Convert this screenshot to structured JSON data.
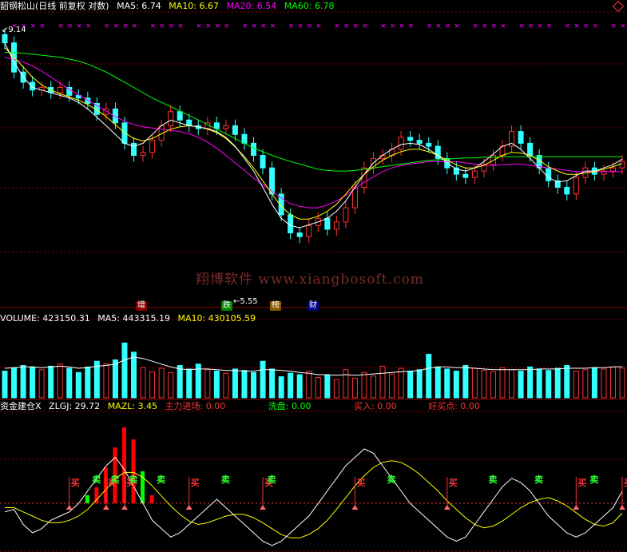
{
  "header_main": {
    "title": "韶钢松山(日线 前复权 对数)",
    "items": [
      {
        "label": "MA5: 6.74",
        "color": "#ffffff"
      },
      {
        "label": "MA10: 6.67",
        "color": "#ffff00"
      },
      {
        "label": "MA20: 6.54",
        "color": "#ff00ff"
      },
      {
        "label": "MA60: 6.78",
        "color": "#00ff00"
      }
    ]
  },
  "header_volume": {
    "items": [
      {
        "label": "VOLUME: 423150.31",
        "color": "#ffffff"
      },
      {
        "label": "MA5: 443315.19",
        "color": "#ffffff"
      },
      {
        "label": "MA10: 430105.59",
        "color": "#ffff00"
      }
    ]
  },
  "header_indicator": {
    "items": [
      {
        "label": "资金建仓X",
        "color": "#ffffff"
      },
      {
        "label": "ZLGJ: 29.72",
        "color": "#ffffff"
      },
      {
        "label": "MAZL: 3.45",
        "color": "#ffff00"
      },
      {
        "label": "主力进场: 0.00",
        "color": "#ff3333"
      },
      {
        "label": "洗盘: 0.00",
        "color": "#00ff00"
      },
      {
        "label": "买入: 0.00",
        "color": "#ff3333"
      },
      {
        "label": "好买点: 0.00",
        "color": "#ff3333"
      }
    ]
  },
  "price_marks": {
    "high": "9.14",
    "low": "5.55"
  },
  "events": [
    {
      "label": "增",
      "bg": "#880000",
      "fg": "#ffffff"
    },
    {
      "label": "跌",
      "bg": "#008800",
      "fg": "#ffffff"
    },
    {
      "label": "榜",
      "bg": "#885500",
      "fg": "#ffffff"
    },
    {
      "label": "财",
      "bg": "#000088",
      "fg": "#ffffff"
    }
  ],
  "watermark": "翔博软件 www.xiangbosoft.com",
  "signals": {
    "buy": "买",
    "sell": "卖"
  },
  "colors": {
    "up": "#ff3333",
    "down": "#33ffff",
    "ma5": "#ffffff",
    "ma10": "#ffff00",
    "ma20": "#ff00ff",
    "ma60": "#00ff00",
    "grid": "#8b0000"
  },
  "chart_data": [
    {
      "type": "candlestick",
      "scale": "log",
      "high_label": 9.14,
      "low_label": 5.55,
      "ylim": [
        5.2,
        9.4
      ],
      "close_approx": [
        8.9,
        8.3,
        8.1,
        7.95,
        8.0,
        7.9,
        8.0,
        7.85,
        7.8,
        7.7,
        7.5,
        7.6,
        7.35,
        7.0,
        6.8,
        6.85,
        7.05,
        7.3,
        7.55,
        7.4,
        7.3,
        7.25,
        7.35,
        7.25,
        7.3,
        7.15,
        7.0,
        6.8,
        6.6,
        6.2,
        5.9,
        5.65,
        5.6,
        5.75,
        5.85,
        5.7,
        5.8,
        6.0,
        6.3,
        6.6,
        6.75,
        6.8,
        6.9,
        7.1,
        7.05,
        7.0,
        6.95,
        6.75,
        6.6,
        6.5,
        6.45,
        6.55,
        6.65,
        6.8,
        6.95,
        7.2,
        7.0,
        6.8,
        6.6,
        6.4,
        6.3,
        6.2,
        6.45,
        6.6,
        6.5,
        6.55,
        6.6,
        6.7
      ],
      "ma5": [
        8.9,
        8.5,
        8.2,
        8.0,
        7.95,
        7.9,
        7.85,
        7.8,
        7.72,
        7.6,
        7.45,
        7.3,
        7.15,
        7.0,
        6.95,
        7.0,
        7.15,
        7.3,
        7.4,
        7.35,
        7.3,
        7.28,
        7.25,
        7.2,
        7.1,
        6.95,
        6.75,
        6.55,
        6.3,
        6.05,
        5.85,
        5.75,
        5.72,
        5.76,
        5.8,
        5.85,
        5.95,
        6.1,
        6.3,
        6.5,
        6.68,
        6.8,
        6.9,
        6.98,
        7.0,
        6.98,
        6.9,
        6.8,
        6.68,
        6.58,
        6.55,
        6.6,
        6.7,
        6.82,
        6.95,
        7.0,
        6.9,
        6.75,
        6.6,
        6.45,
        6.38,
        6.4,
        6.48,
        6.55,
        6.55,
        6.6,
        6.65,
        6.74
      ],
      "ma10": [
        8.8,
        8.6,
        8.4,
        8.2,
        8.05,
        7.95,
        7.88,
        7.82,
        7.76,
        7.68,
        7.58,
        7.46,
        7.32,
        7.18,
        7.08,
        7.04,
        7.08,
        7.16,
        7.24,
        7.28,
        7.3,
        7.28,
        7.24,
        7.18,
        7.08,
        6.94,
        6.78,
        6.6,
        6.4,
        6.2,
        6.02,
        5.9,
        5.84,
        5.84,
        5.88,
        5.95,
        6.05,
        6.2,
        6.36,
        6.5,
        6.62,
        6.72,
        6.8,
        6.86,
        6.9,
        6.9,
        6.86,
        6.8,
        6.72,
        6.65,
        6.6,
        6.6,
        6.64,
        6.72,
        6.8,
        6.85,
        6.84,
        6.8,
        6.72,
        6.62,
        6.55,
        6.5,
        6.5,
        6.52,
        6.54,
        6.58,
        6.62,
        6.67
      ],
      "ma20": [
        8.6,
        8.55,
        8.5,
        8.42,
        8.32,
        8.2,
        8.08,
        7.96,
        7.86,
        7.76,
        7.66,
        7.56,
        7.46,
        7.38,
        7.32,
        7.28,
        7.26,
        7.24,
        7.22,
        7.2,
        7.16,
        7.1,
        7.02,
        6.92,
        6.8,
        6.68,
        6.56,
        6.44,
        6.34,
        6.24,
        6.14,
        6.06,
        6.02,
        6.0,
        6.0,
        6.04,
        6.1,
        6.18,
        6.28,
        6.38,
        6.46,
        6.54,
        6.6,
        6.64,
        6.66,
        6.68,
        6.7,
        6.7,
        6.7,
        6.7,
        6.68,
        6.66,
        6.64,
        6.64,
        6.65,
        6.66,
        6.66,
        6.64,
        6.62,
        6.6,
        6.58,
        6.56,
        6.54,
        6.54,
        6.54,
        6.54,
        6.54,
        6.54
      ],
      "ma60": [
        8.7,
        8.7,
        8.68,
        8.66,
        8.64,
        8.62,
        8.6,
        8.56,
        8.52,
        8.46,
        8.38,
        8.3,
        8.2,
        8.1,
        8.0,
        7.9,
        7.8,
        7.72,
        7.64,
        7.56,
        7.48,
        7.4,
        7.32,
        7.24,
        7.16,
        7.08,
        7.0,
        6.92,
        6.86,
        6.8,
        6.75,
        6.7,
        6.66,
        6.62,
        6.58,
        6.56,
        6.55,
        6.55,
        6.56,
        6.58,
        6.6,
        6.62,
        6.64,
        6.66,
        6.68,
        6.7,
        6.72,
        6.73,
        6.74,
        6.75,
        6.76,
        6.76,
        6.77,
        6.77,
        6.78,
        6.78,
        6.78,
        6.78,
        6.78,
        6.78,
        6.78,
        6.78,
        6.78,
        6.78,
        6.78,
        6.78,
        6.78,
        6.78
      ]
    },
    {
      "type": "bar",
      "name": "VOLUME",
      "ylim": [
        0,
        1000000
      ],
      "values_approx": [
        380000,
        420000,
        460000,
        440000,
        400000,
        450000,
        480000,
        420000,
        360000,
        440000,
        520000,
        480000,
        540000,
        780000,
        650000,
        430000,
        370000,
        420000,
        360000,
        460000,
        410000,
        480000,
        400000,
        380000,
        350000,
        410000,
        390000,
        360000,
        520000,
        410000,
        300000,
        350000,
        330000,
        380000,
        290000,
        320000,
        260000,
        400000,
        280000,
        360000,
        310000,
        450000,
        340000,
        420000,
        380000,
        400000,
        620000,
        440000,
        410000,
        380000,
        460000,
        420000,
        390000,
        370000,
        430000,
        400000,
        380000,
        440000,
        410000,
        390000,
        420000,
        460000,
        380000,
        400000,
        430000,
        410000,
        440000,
        423150
      ],
      "ma5_approx": [
        420000,
        430000,
        440000,
        440000,
        430000,
        440000,
        450000,
        440000,
        420000,
        430000,
        450000,
        460000,
        480000,
        540000,
        580000,
        560000,
        520000,
        480000,
        440000,
        410000,
        400000,
        410000,
        410000,
        400000,
        390000,
        390000,
        380000,
        380000,
        400000,
        400000,
        390000,
        380000,
        360000,
        350000,
        330000,
        330000,
        320000,
        330000,
        320000,
        330000,
        340000,
        350000,
        360000,
        370000,
        380000,
        390000,
        420000,
        440000,
        440000,
        430000,
        430000,
        420000,
        410000,
        400000,
        400000,
        400000,
        400000,
        400000,
        410000,
        410000,
        410000,
        420000,
        420000,
        420000,
        430000,
        430000,
        440000,
        443315
      ]
    },
    {
      "type": "line",
      "name": "ZLGJ",
      "ylim": [
        -40,
        120
      ],
      "zlgj_approx": [
        5,
        8,
        -10,
        -20,
        -15,
        -5,
        0,
        5,
        15,
        30,
        45,
        60,
        70,
        55,
        35,
        15,
        -5,
        -15,
        -25,
        -20,
        -10,
        0,
        10,
        20,
        10,
        0,
        -10,
        -20,
        -30,
        -35,
        -30,
        -20,
        -10,
        0,
        15,
        30,
        45,
        60,
        70,
        80,
        75,
        60,
        45,
        30,
        15,
        5,
        -5,
        -15,
        -25,
        -30,
        -25,
        -10,
        5,
        20,
        35,
        45,
        40,
        30,
        15,
        0,
        -10,
        -20,
        -25,
        -20,
        -10,
        0,
        10,
        29.72
      ],
      "mazl_approx": [
        10,
        10,
        5,
        0,
        -5,
        -8,
        -8,
        -5,
        0,
        8,
        20,
        32,
        45,
        52,
        52,
        46,
        36,
        24,
        12,
        2,
        -6,
        -10,
        -8,
        -4,
        0,
        2,
        2,
        -2,
        -8,
        -15,
        -22,
        -26,
        -26,
        -22,
        -15,
        -5,
        8,
        22,
        36,
        48,
        58,
        64,
        66,
        64,
        58,
        50,
        40,
        30,
        18,
        8,
        -2,
        -10,
        -14,
        -12,
        -6,
        2,
        10,
        16,
        20,
        22,
        18,
        12,
        4,
        -4,
        -10,
        -12,
        -8,
        3.45
      ],
      "bars_approx": [
        0,
        0,
        0,
        0,
        0,
        0,
        0,
        0,
        0,
        10,
        20,
        45,
        70,
        95,
        80,
        40,
        10,
        0,
        0,
        0,
        0,
        0,
        0,
        0,
        0,
        0,
        0,
        0,
        0,
        0,
        0,
        0,
        0,
        0,
        0,
        0,
        0,
        0,
        0,
        0,
        0,
        0,
        0,
        0,
        0,
        0,
        0,
        0,
        0,
        0,
        0,
        0,
        0,
        0,
        0,
        0,
        0,
        0,
        0,
        0,
        0,
        0,
        0,
        0,
        0,
        0,
        0,
        0
      ]
    }
  ]
}
